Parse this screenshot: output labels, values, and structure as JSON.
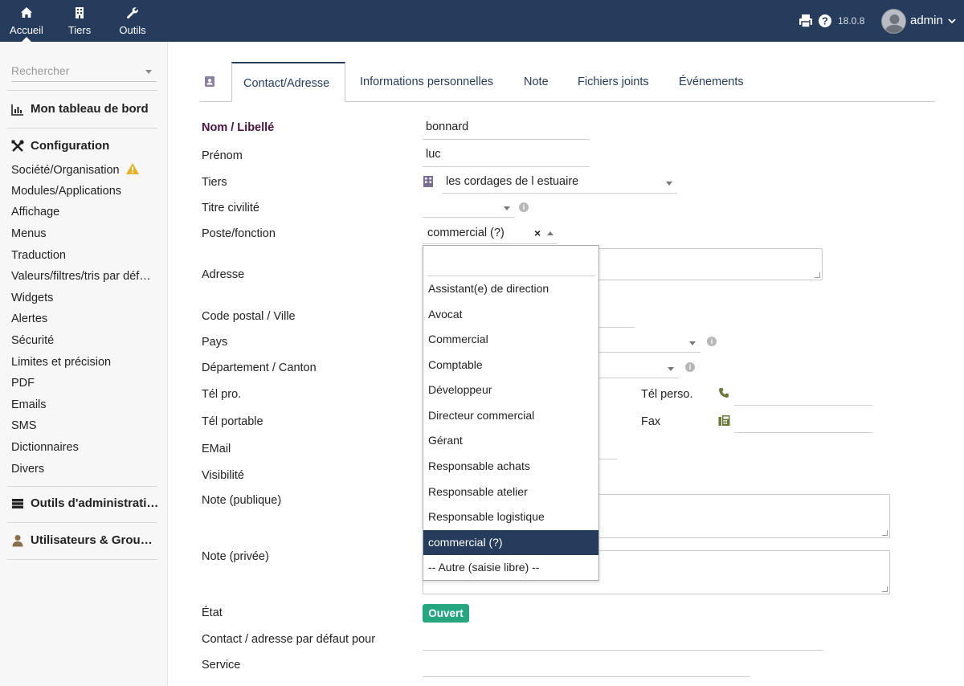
{
  "topbar": {
    "nav": [
      {
        "label": "Accueil",
        "icon": "home-icon"
      },
      {
        "label": "Tiers",
        "icon": "building-icon"
      },
      {
        "label": "Outils",
        "icon": "wrench-icon"
      }
    ],
    "version": "18.0.8",
    "user": "admin"
  },
  "sidebar": {
    "search_placeholder": "Rechercher",
    "dashboard": "Mon tableau de bord",
    "config_title": "Configuration",
    "config_items": [
      "Société/Organisation",
      "Modules/Applications",
      "Affichage",
      "Menus",
      "Traduction",
      "Valeurs/filtres/tris par défaut",
      "Widgets",
      "Alertes",
      "Sécurité",
      "Limites et précision",
      "PDF",
      "Emails",
      "SMS",
      "Dictionnaires",
      "Divers"
    ],
    "admin_tools": "Outils d'administration",
    "users_groups": "Utilisateurs & Groupes"
  },
  "tabs": [
    "Contact/Adresse",
    "Informations personnelles",
    "Note",
    "Fichiers joints",
    "Événements"
  ],
  "form": {
    "nom_label": "Nom / Libellé",
    "nom_value": "bonnard",
    "prenom_label": "Prénom",
    "prenom_value": "luc",
    "tiers_label": "Tiers",
    "tiers_value": "les cordages de l estuaire",
    "civilite_label": "Titre civilité",
    "poste_label": "Poste/fonction",
    "poste_value": "commercial (?)",
    "adresse_label": "Adresse",
    "cp_ville_label": "Code postal / Ville",
    "pays_label": "Pays",
    "departement_label": "Département / Canton",
    "tel_pro_label": "Tél pro.",
    "tel_perso_label": "Tél perso.",
    "tel_portable_label": "Tél portable",
    "fax_label": "Fax",
    "email_label": "EMail",
    "visibilite_label": "Visibilité",
    "note_publique_label": "Note (publique)",
    "note_privee_label": "Note (privée)",
    "etat_label": "État",
    "etat_value": "Ouvert",
    "contact_defaut_label": "Contact / adresse par défaut pour",
    "service_label": "Service"
  },
  "dropdown": {
    "options": [
      "Assistant(e) de direction",
      "Avocat",
      "Commercial",
      "Comptable",
      "Développeur",
      "Directeur commercial",
      "Gérant",
      "Responsable achats",
      "Responsable atelier",
      "Responsable logistique",
      "commercial (?)",
      "-- Autre (saisie libre) --"
    ],
    "selected": "commercial (?)"
  },
  "colors": {
    "topbar": "#263c5c",
    "required_label": "#4b1242",
    "status_open": "#25a580",
    "dropdown_selected": "#263c5c"
  }
}
